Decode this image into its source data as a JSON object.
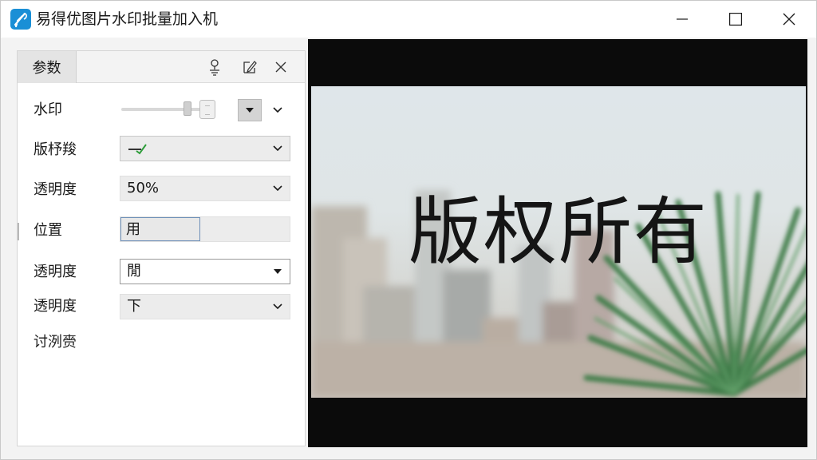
{
  "window": {
    "title": "易得优图片水印批量加入机"
  },
  "panel": {
    "tab_label": "参数",
    "rows": {
      "watermark_label": "水印",
      "copyright_label": "版杼羧",
      "opacity_label": "透明度",
      "opacity_value": "50%",
      "position_label": "位置",
      "position_value": "用",
      "opacity2_label": "透明度",
      "opacity2_value": "閒",
      "opacity3_label": "透明度",
      "opacity3_value": "下",
      "extra_label": "讨洌赍"
    }
  },
  "preview": {
    "watermark_text": "版权所有"
  },
  "colors": {
    "accent": "#1a8fd6",
    "check_green": "#2e9d3a",
    "focus_border": "#6d8fb8"
  },
  "icons": {
    "app": "feather-pen-icon",
    "minimize": "minimize-icon",
    "maximize": "maximize-icon",
    "close": "close-icon",
    "panel_pin": "person-pin-icon",
    "panel_edit": "edit-icon",
    "panel_close": "close-icon"
  }
}
